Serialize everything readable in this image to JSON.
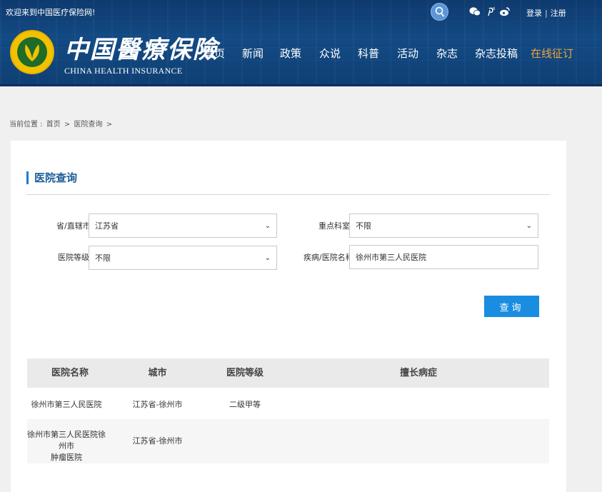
{
  "header": {
    "welcome": "欢迎来到中国医疗保险网!",
    "logo_cn": "中国醫療保險",
    "logo_en": "CHINA HEALTH INSURANCE",
    "login": "登录",
    "separator": "|",
    "register": "注册",
    "social_icons": [
      "wechat-icon",
      "pinterest-icon",
      "weibo-icon"
    ]
  },
  "nav": {
    "items": [
      {
        "label": "首页"
      },
      {
        "label": "新闻"
      },
      {
        "label": "政策"
      },
      {
        "label": "众说"
      },
      {
        "label": "科普"
      },
      {
        "label": "活动"
      },
      {
        "label": "杂志"
      },
      {
        "label": "杂志投稿"
      },
      {
        "label": "在线征订"
      }
    ],
    "active_color": "#f0a63a"
  },
  "breadcrumb": {
    "prefix": "当前位置 : ",
    "home": "首页",
    "sep1": ">",
    "current": "医院查询",
    "sep2": ">"
  },
  "page": {
    "title": "医院查询"
  },
  "form": {
    "province_label": "省/直辖市",
    "province_value": "江苏省",
    "department_label": "重点科室",
    "department_value": "不限",
    "level_label": "医院等级",
    "level_value": "不限",
    "name_label": "疾病/医院名称",
    "name_value": "徐州市第三人民医院",
    "query_button": "查询"
  },
  "table": {
    "headers": [
      "医院名称",
      "城市",
      "医院等级",
      "擅长病症"
    ],
    "rows": [
      {
        "name": "徐州市第三人民医院",
        "city": "江苏省-徐州市",
        "level": "二级甲等",
        "specialty": ""
      },
      {
        "name_line1": "徐州市第三人民医院徐州市",
        "name_line2": "肿瘤医院",
        "city": "江苏省-徐州市",
        "level": "",
        "specialty": ""
      }
    ]
  },
  "colors": {
    "header_bg": "#134a84",
    "accent_blue": "#1a8de0",
    "title_blue": "#1a5c9a"
  }
}
